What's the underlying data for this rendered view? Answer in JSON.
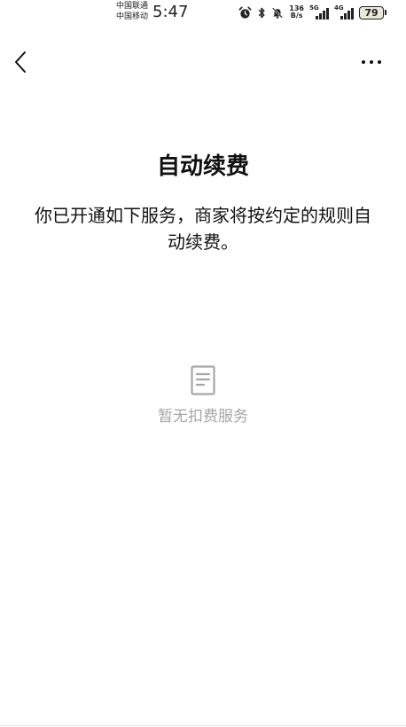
{
  "status_bar": {
    "carrier_1": "中国联通",
    "carrier_2": "中国移动",
    "time": "5:47",
    "net_speed_value": "136",
    "net_speed_unit": "B/s",
    "signal_1_label": "5G",
    "signal_2_label": "4G",
    "battery_level": "79",
    "icons": [
      "alarm-icon",
      "bluetooth-icon",
      "mute-icon",
      "signal-5g-icon",
      "signal-4g-icon",
      "battery-icon"
    ]
  },
  "nav": {
    "back_icon": "chevron-left-icon",
    "more_icon": "more-dots-icon"
  },
  "main": {
    "title": "自动续费",
    "description": "你已开通如下服务，商家将按约定的规则自动续费。",
    "empty_state": {
      "icon": "document-icon",
      "text": "暂无扣费服务",
      "color": "#a6a6a6"
    }
  }
}
